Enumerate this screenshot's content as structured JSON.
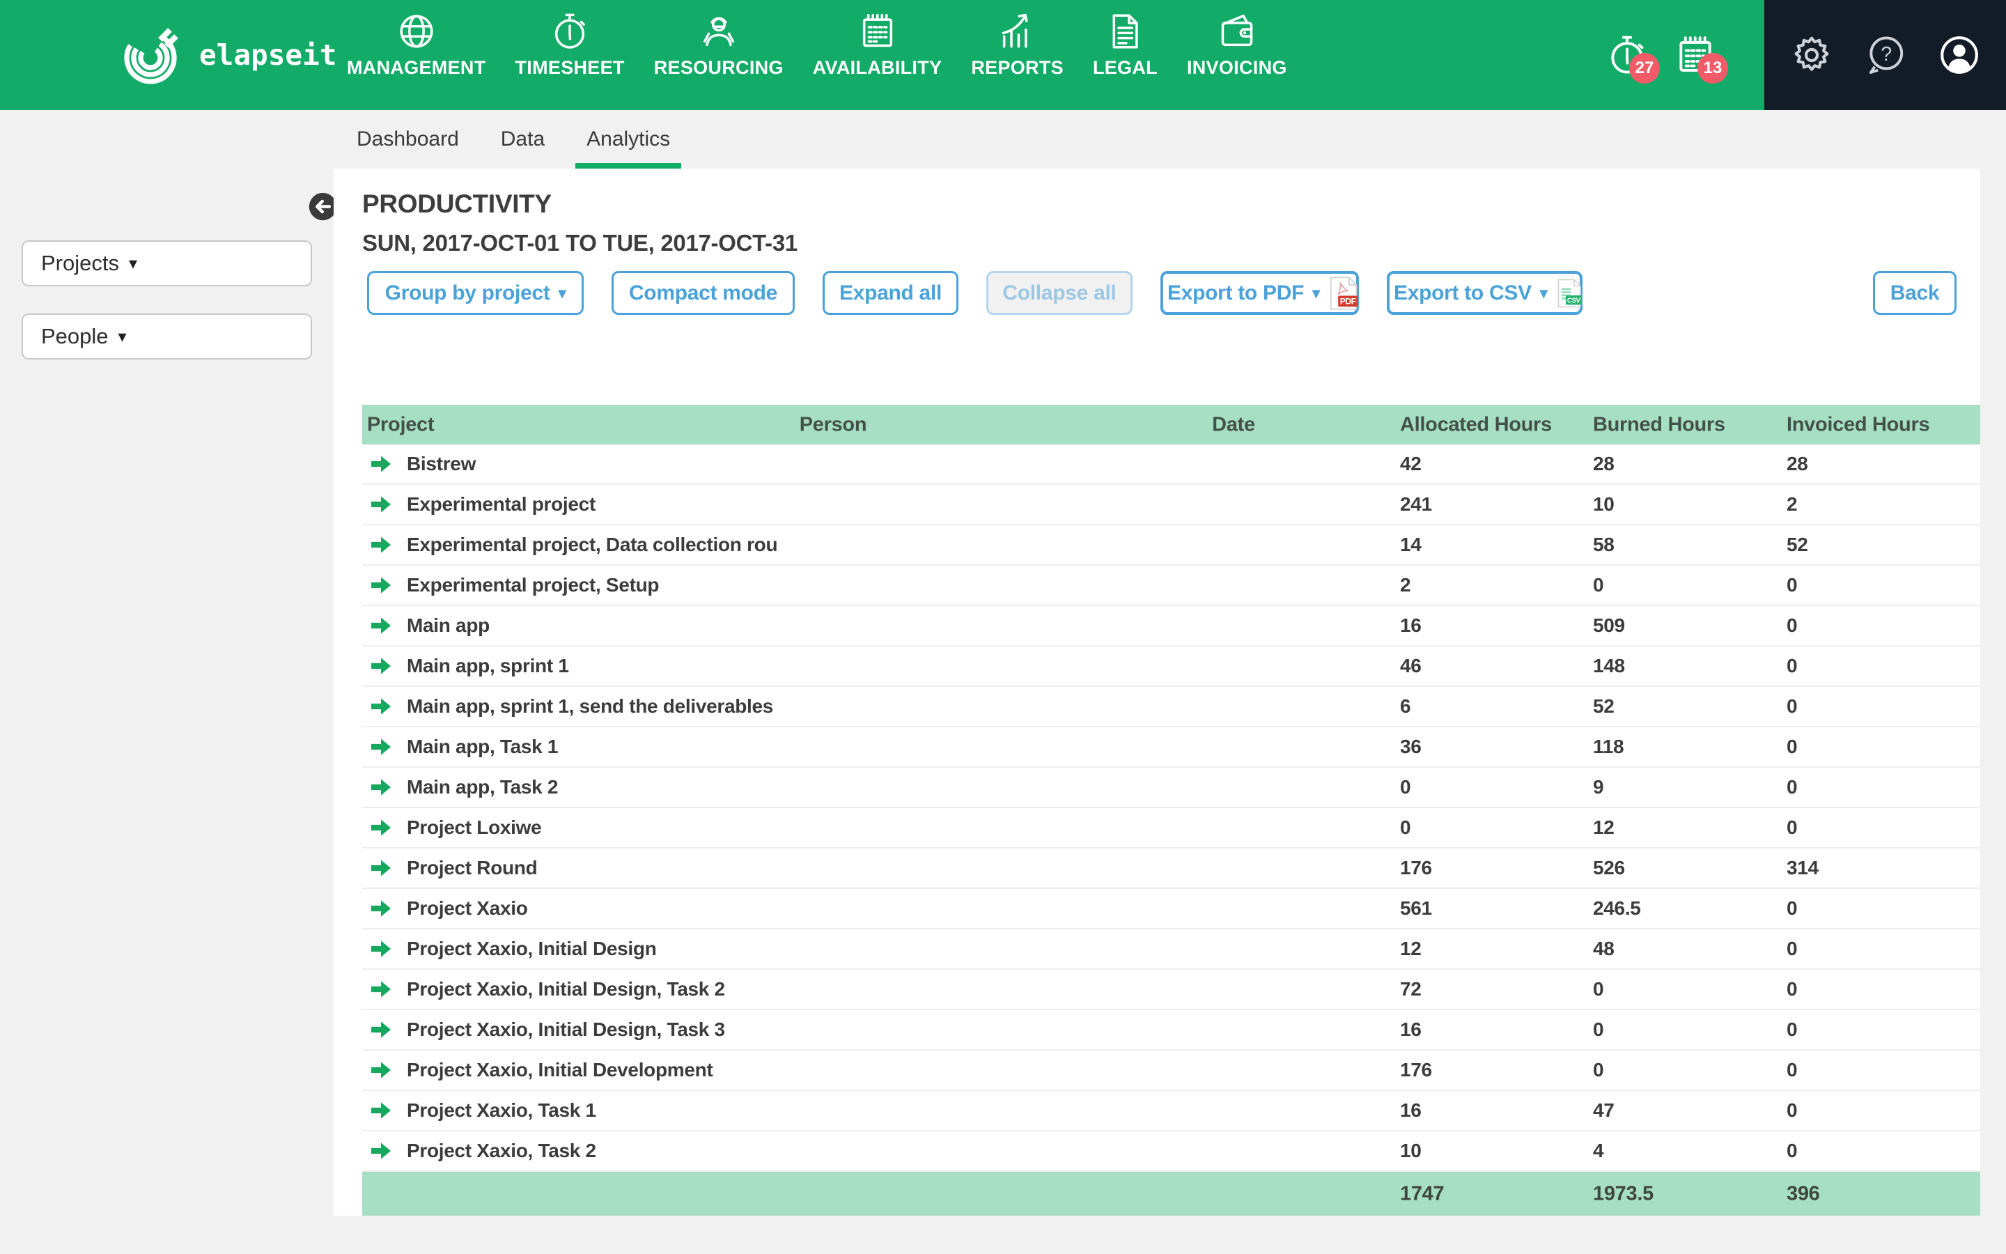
{
  "navbar": {
    "brand": "elapseit",
    "items": [
      {
        "id": "management",
        "label": "MANAGEMENT",
        "icon": "globe-icon",
        "active": false
      },
      {
        "id": "timesheet",
        "label": "TIMESHEET",
        "icon": "stopwatch-icon",
        "active": false
      },
      {
        "id": "resourcing",
        "label": "RESOURCING",
        "icon": "worker-icon",
        "active": false
      },
      {
        "id": "availability",
        "label": "AVAILABILITY",
        "icon": "notepad-icon",
        "active": false
      },
      {
        "id": "reports",
        "label": "REPORTS",
        "icon": "chart-icon",
        "active": true
      },
      {
        "id": "legal",
        "label": "LEGAL",
        "icon": "document-icon",
        "active": false
      },
      {
        "id": "invoicing",
        "label": "INVOICING",
        "icon": "wallet-icon",
        "active": false
      }
    ],
    "timer_badge": "27",
    "calendar_badge": "13"
  },
  "tabs": {
    "items": [
      {
        "label": "Dashboard",
        "active": false
      },
      {
        "label": "Data",
        "active": false
      },
      {
        "label": "Analytics",
        "active": true
      }
    ]
  },
  "sidebar": {
    "filters": [
      {
        "label": "Projects"
      },
      {
        "label": "People"
      }
    ]
  },
  "report": {
    "title": "PRODUCTIVITY",
    "date_range": "SUN, 2017-OCT-01 TO TUE, 2017-OCT-31",
    "toolbar": {
      "group_by": "Group by project",
      "compact": "Compact mode",
      "expand": "Expand all",
      "collapse": "Collapse all",
      "export_pdf": "Export to PDF",
      "export_csv": "Export to CSV",
      "back": "Back"
    }
  },
  "table": {
    "columns": [
      "Project",
      "Person",
      "Date",
      "Allocated Hours",
      "Burned Hours",
      "Invoiced Hours"
    ],
    "rows": [
      {
        "project": "Bistrew",
        "allocated": "42",
        "burned": "28",
        "invoiced": "28"
      },
      {
        "project": "Experimental project",
        "allocated": "241",
        "burned": "10",
        "invoiced": "2"
      },
      {
        "project": "Experimental project, Data collection rou",
        "allocated": "14",
        "burned": "58",
        "invoiced": "52"
      },
      {
        "project": "Experimental project, Setup",
        "allocated": "2",
        "burned": "0",
        "invoiced": "0"
      },
      {
        "project": "Main app",
        "allocated": "16",
        "burned": "509",
        "invoiced": "0"
      },
      {
        "project": "Main app, sprint 1",
        "allocated": "46",
        "burned": "148",
        "invoiced": "0"
      },
      {
        "project": "Main app, sprint 1, send the deliverables",
        "allocated": "6",
        "burned": "52",
        "invoiced": "0"
      },
      {
        "project": "Main app, Task 1",
        "allocated": "36",
        "burned": "118",
        "invoiced": "0"
      },
      {
        "project": "Main app, Task 2",
        "allocated": "0",
        "burned": "9",
        "invoiced": "0"
      },
      {
        "project": "Project Loxiwe",
        "allocated": "0",
        "burned": "12",
        "invoiced": "0"
      },
      {
        "project": "Project Round",
        "allocated": "176",
        "burned": "526",
        "invoiced": "314"
      },
      {
        "project": "Project Xaxio",
        "allocated": "561",
        "burned": "246.5",
        "invoiced": "0"
      },
      {
        "project": "Project Xaxio, Initial Design",
        "allocated": "12",
        "burned": "48",
        "invoiced": "0"
      },
      {
        "project": "Project Xaxio, Initial Design, Task 2",
        "allocated": "72",
        "burned": "0",
        "invoiced": "0"
      },
      {
        "project": "Project Xaxio, Initial Design, Task 3",
        "allocated": "16",
        "burned": "0",
        "invoiced": "0"
      },
      {
        "project": "Project Xaxio, Initial Development",
        "allocated": "176",
        "burned": "0",
        "invoiced": "0"
      },
      {
        "project": "Project Xaxio, Task 1",
        "allocated": "16",
        "burned": "47",
        "invoiced": "0"
      },
      {
        "project": "Project Xaxio, Task 2",
        "allocated": "10",
        "burned": "4",
        "invoiced": "0"
      }
    ],
    "totals": {
      "allocated": "1747",
      "burned": "1973.5",
      "invoiced": "396"
    }
  },
  "colors": {
    "accent_green": "#12ab67",
    "pale_green": "#a6dfc3",
    "badge_red": "#f15b67",
    "button_blue": "#4aa2d9",
    "dark_panel": "#131b26"
  }
}
